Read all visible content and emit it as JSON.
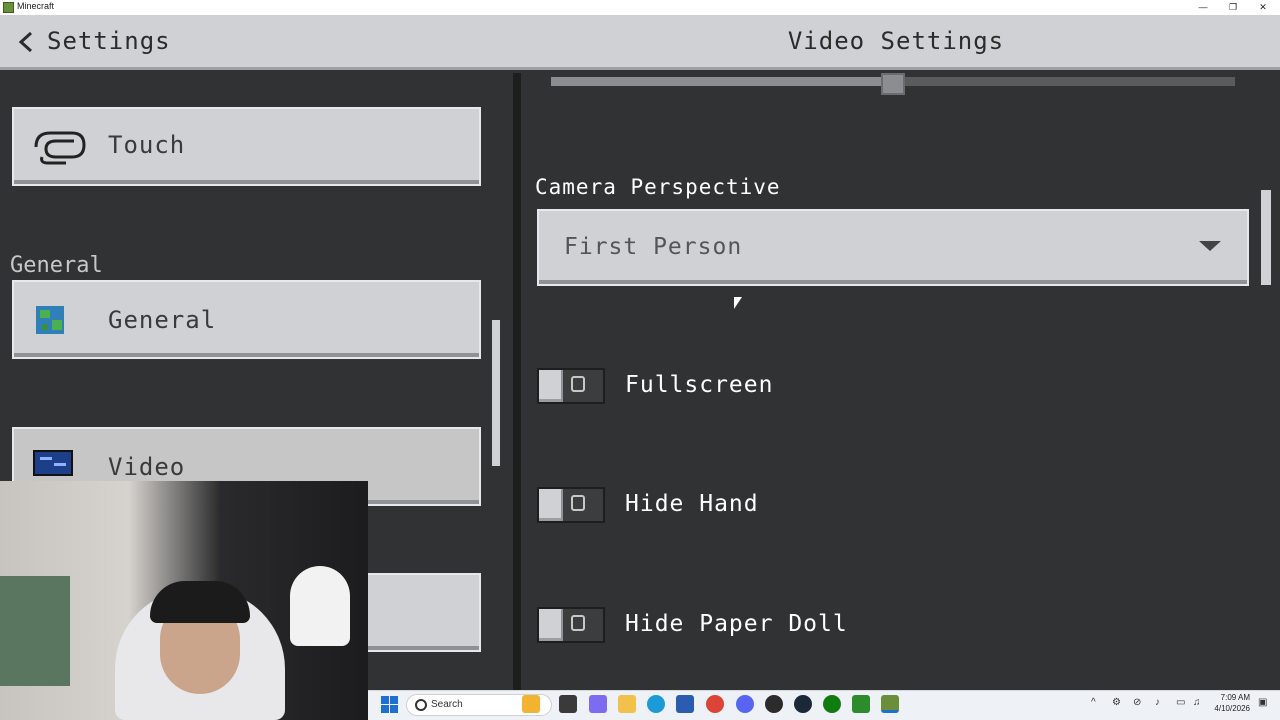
{
  "window": {
    "title": "Minecraft",
    "controls": [
      "—",
      "❐",
      "✕"
    ]
  },
  "header": {
    "back_label": "Settings",
    "title": "Video Settings"
  },
  "sidebar": {
    "section_label": "General",
    "items": [
      {
        "label": "Touch",
        "icon": "touch-hand-icon"
      },
      {
        "label": "General",
        "icon": "globe-icon"
      },
      {
        "label": "Video",
        "icon": "monitor-icon",
        "selected": true
      }
    ]
  },
  "video_settings": {
    "camera_perspective": {
      "label": "Camera Perspective",
      "value": "First Person"
    },
    "toggles": [
      {
        "label": "Fullscreen",
        "on": false
      },
      {
        "label": "Hide Hand",
        "on": false
      },
      {
        "label": "Hide Paper Doll",
        "on": false
      }
    ]
  },
  "taskbar": {
    "search_placeholder": "Search",
    "clock_time": "7:09 AM",
    "clock_date": "4/10/2026",
    "apps": [
      "file-explorer-icon",
      "edge-icon",
      "store-icon",
      "chrome-icon",
      "discord-icon",
      "obs-icon",
      "steam-icon",
      "xbox-icon",
      "minecraft-icon"
    ]
  },
  "colors": {
    "panel_bg": "#313233",
    "button_bg": "#d0d1d4",
    "header_bg": "#d0d1d4"
  }
}
